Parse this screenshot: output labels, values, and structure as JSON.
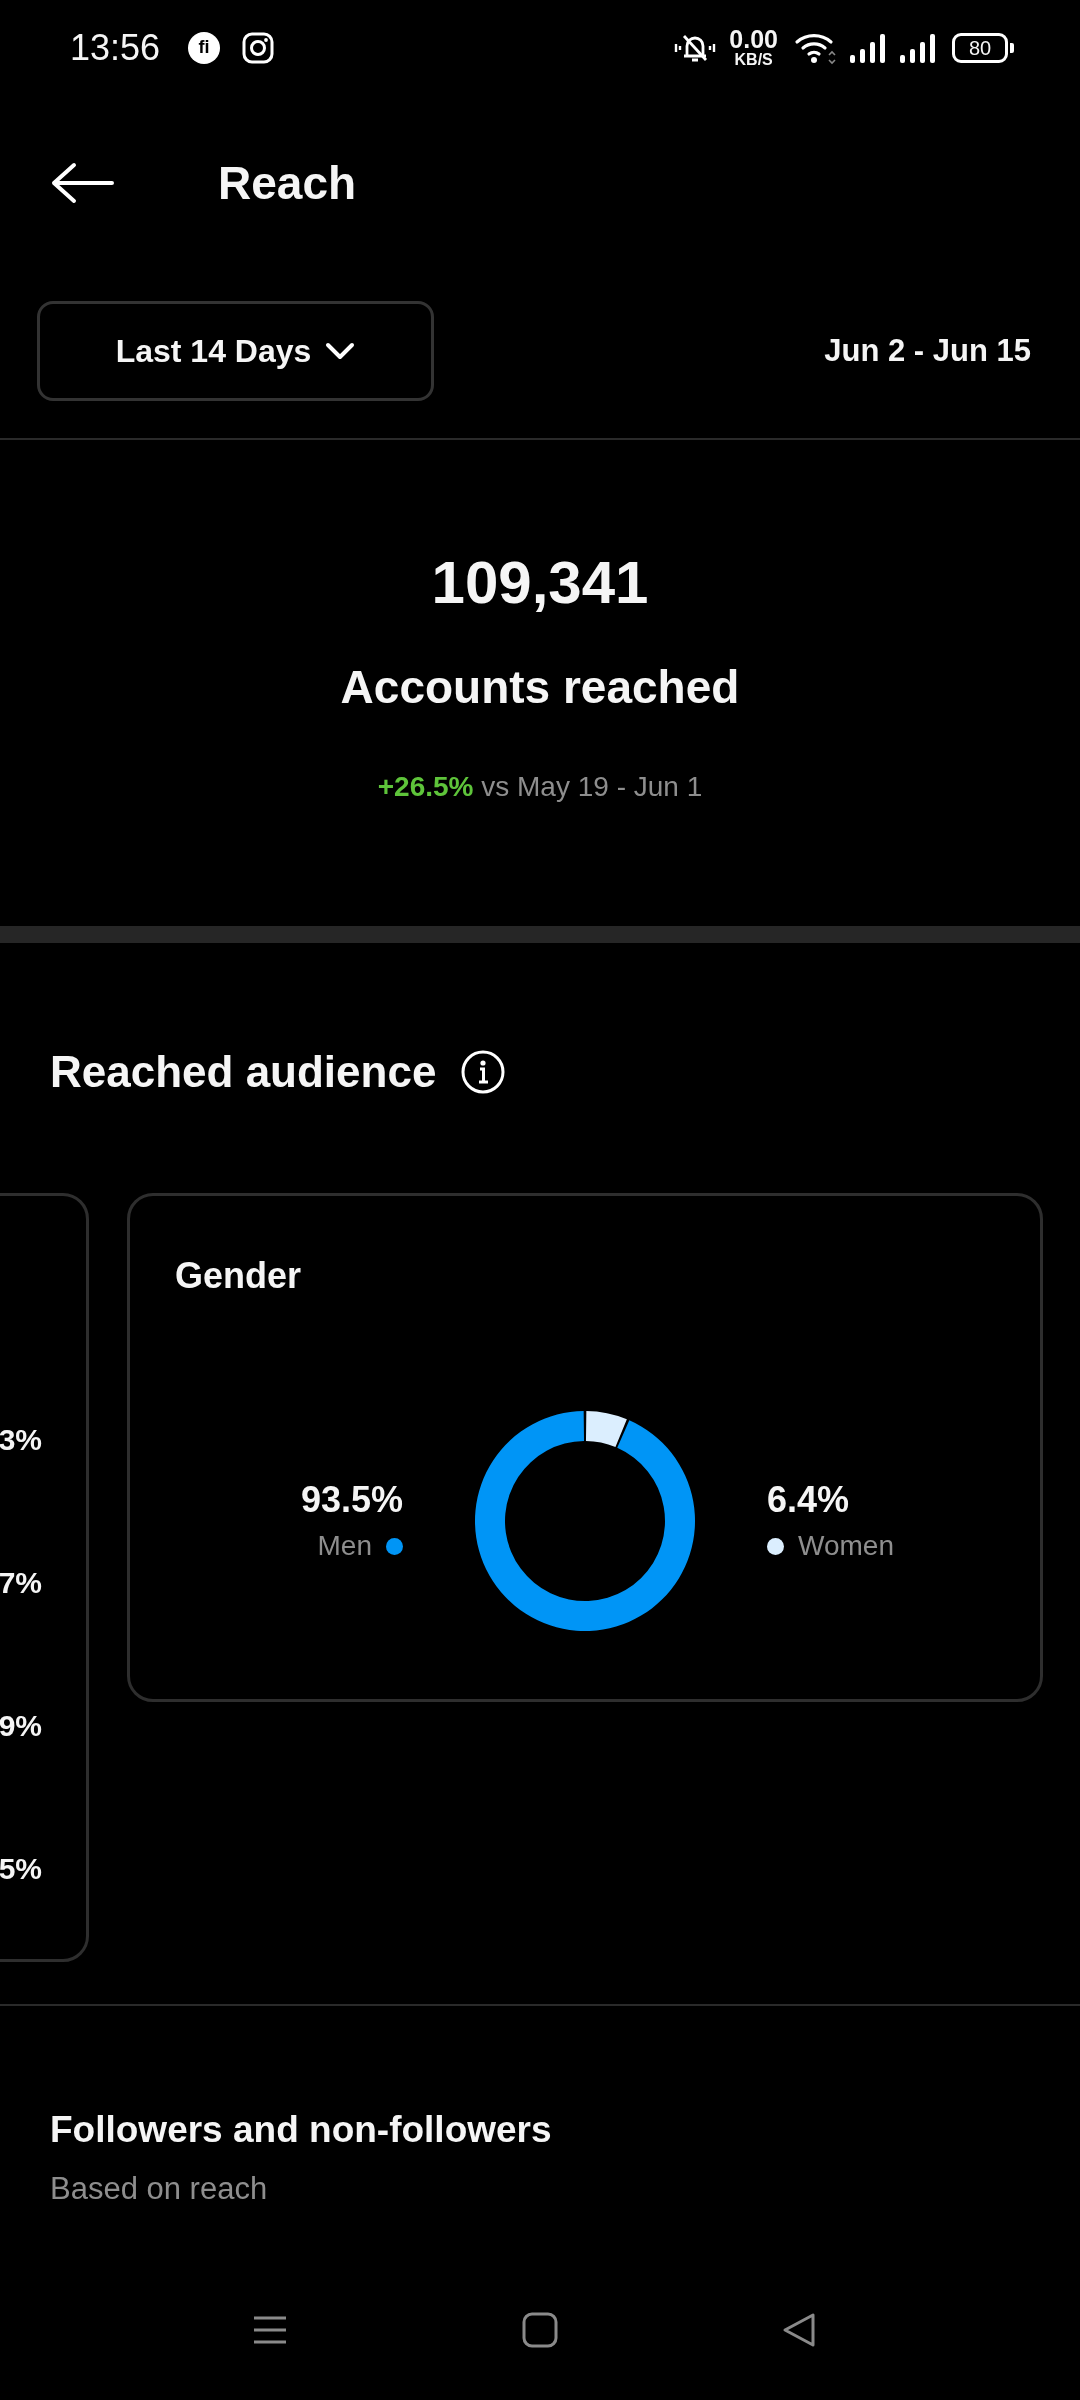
{
  "status_bar": {
    "time": "13:56",
    "app_badge": "fi",
    "net_speed": "0.00",
    "net_unit": "KB/S",
    "battery": "80"
  },
  "header": {
    "title": "Reach"
  },
  "date_filter": {
    "label": "Last 14 Days",
    "range": "Jun 2 - Jun 15"
  },
  "summary": {
    "value": "109,341",
    "label": "Accounts reached",
    "change": "+26.5%",
    "comparison": "vs May 19 - Jun 1"
  },
  "reached_audience": {
    "title": "Reached audience",
    "previous_card": {
      "values": [
        "3%",
        "7%",
        "9%",
        "5%"
      ]
    },
    "gender_card": {
      "title": "Gender",
      "legend": [
        {
          "value": "93.5%",
          "color": "#0095f6"
        },
        {
          "value": "6.4%",
          "color": "#dbeefe"
        }
      ],
      "chart_data": {
        "type": "donut",
        "categories": [
          "Men",
          "Women"
        ],
        "values": [
          93.5,
          6.4
        ]
      }
    }
  },
  "followers_section": {
    "title": "Followers and non-followers",
    "subtitle": "Based on reach"
  }
}
